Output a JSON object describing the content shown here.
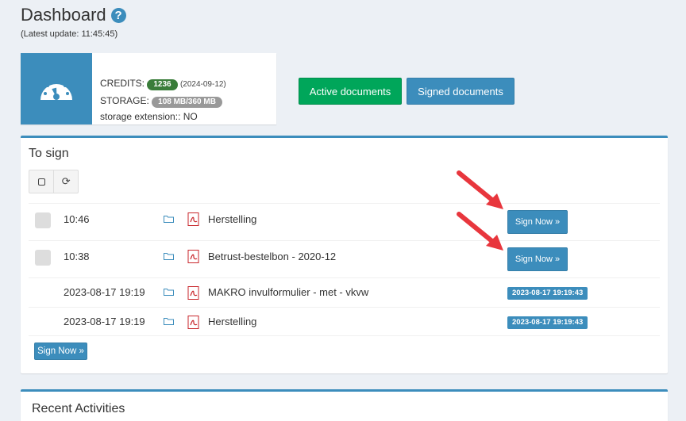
{
  "header": {
    "title": "Dashboard",
    "help_icon": "?",
    "last_update": "(Latest update: 11:45:45)"
  },
  "info_box": {
    "icon": "dashboard-gauge-icon",
    "credits_label": "CREDITS:",
    "credits_value": "1236",
    "credits_date": "(2024-09-12)",
    "storage_label": "STORAGE:",
    "storage_value": "108 MB/360 MB",
    "storage_extension": "storage extension:: NO"
  },
  "buttons": {
    "active_documents": "Active documents",
    "signed_documents": "Signed documents"
  },
  "to_sign": {
    "title": "To sign",
    "toolbar": {
      "select_icon": "square-icon",
      "refresh_icon": "⟳"
    },
    "rows": [
      {
        "time": "10:46",
        "name": "Herstelling",
        "action": "Sign Now »",
        "has_checkbox": true
      },
      {
        "time": "10:38",
        "name": "Betrust-bestelbon - 2020-12",
        "action": "Sign Now »",
        "has_checkbox": true
      },
      {
        "time": "2023-08-17 19:19",
        "name": "MAKRO invulformulier - met - vkvw",
        "badge": "2023-08-17 19:19:43",
        "has_checkbox": false
      },
      {
        "time": "2023-08-17 19:19",
        "name": "Herstelling",
        "badge": "2023-08-17 19:19:43",
        "has_checkbox": false
      }
    ],
    "bulk_sign": "Sign Now »"
  },
  "recent": {
    "title": "Recent Activities"
  },
  "colors": {
    "primary": "#3c8dbc",
    "success": "#00a65a",
    "arrow": "#e8363d",
    "credits_badge": "#3a7d3a"
  }
}
